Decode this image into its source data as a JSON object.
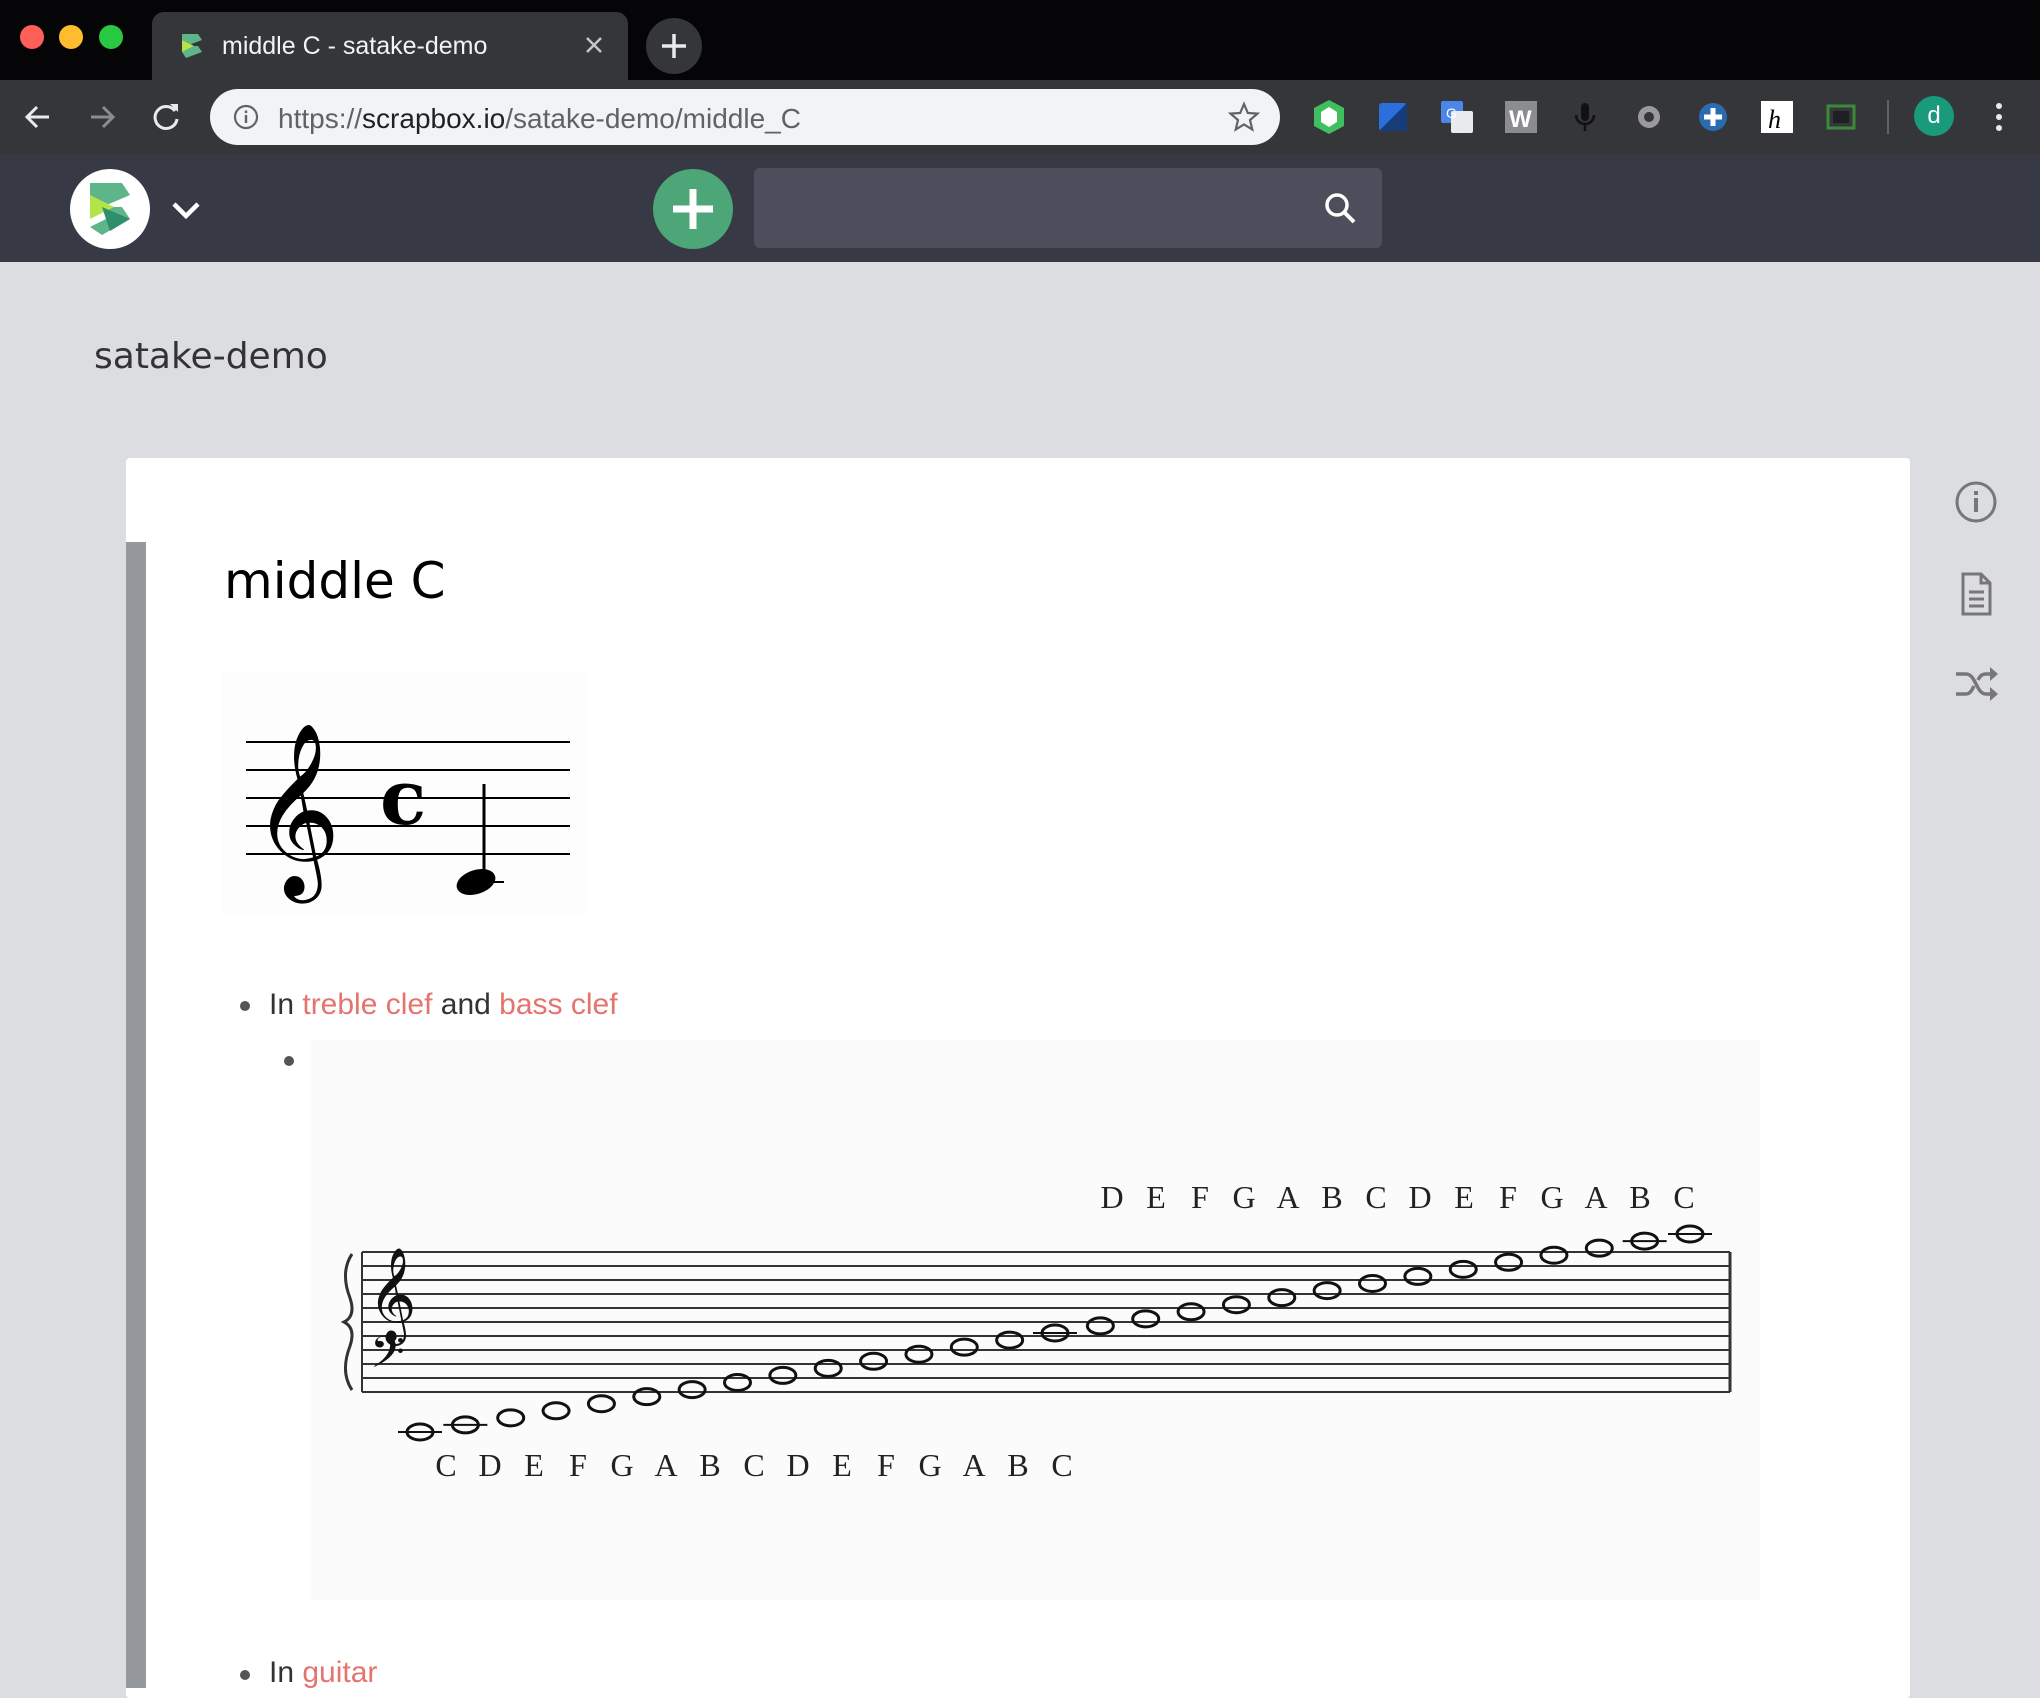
{
  "window": {
    "tab_title": "middle C - satake-demo",
    "url_scheme": "https://",
    "url_host": "scrapbox.io",
    "url_path": "/satake-demo/middle_C",
    "profile_initial": "d"
  },
  "app": {
    "search_placeholder": "",
    "project_name": "satake-demo"
  },
  "page": {
    "title": "middle C",
    "line1": {
      "prefix": "In ",
      "link1": "treble clef",
      "middle": " and ",
      "link2": "bass clef"
    },
    "line2": {
      "prefix": "In ",
      "link1": "guitar"
    },
    "scale_top_labels": [
      "D",
      "E",
      "F",
      "G",
      "A",
      "B",
      "C",
      "D",
      "E",
      "F",
      "G",
      "A",
      "B",
      "C"
    ],
    "scale_bottom_labels": [
      "C",
      "D",
      "E",
      "F",
      "G",
      "A",
      "B",
      "C",
      "D",
      "E",
      "F",
      "G",
      "A",
      "B",
      "C"
    ]
  },
  "sidebar": {
    "icons": [
      "info-icon",
      "document-icon",
      "shuffle-icon"
    ]
  },
  "colors": {
    "link": "#e5736e",
    "accent_green": "#4da678",
    "appbar": "#373a45"
  }
}
